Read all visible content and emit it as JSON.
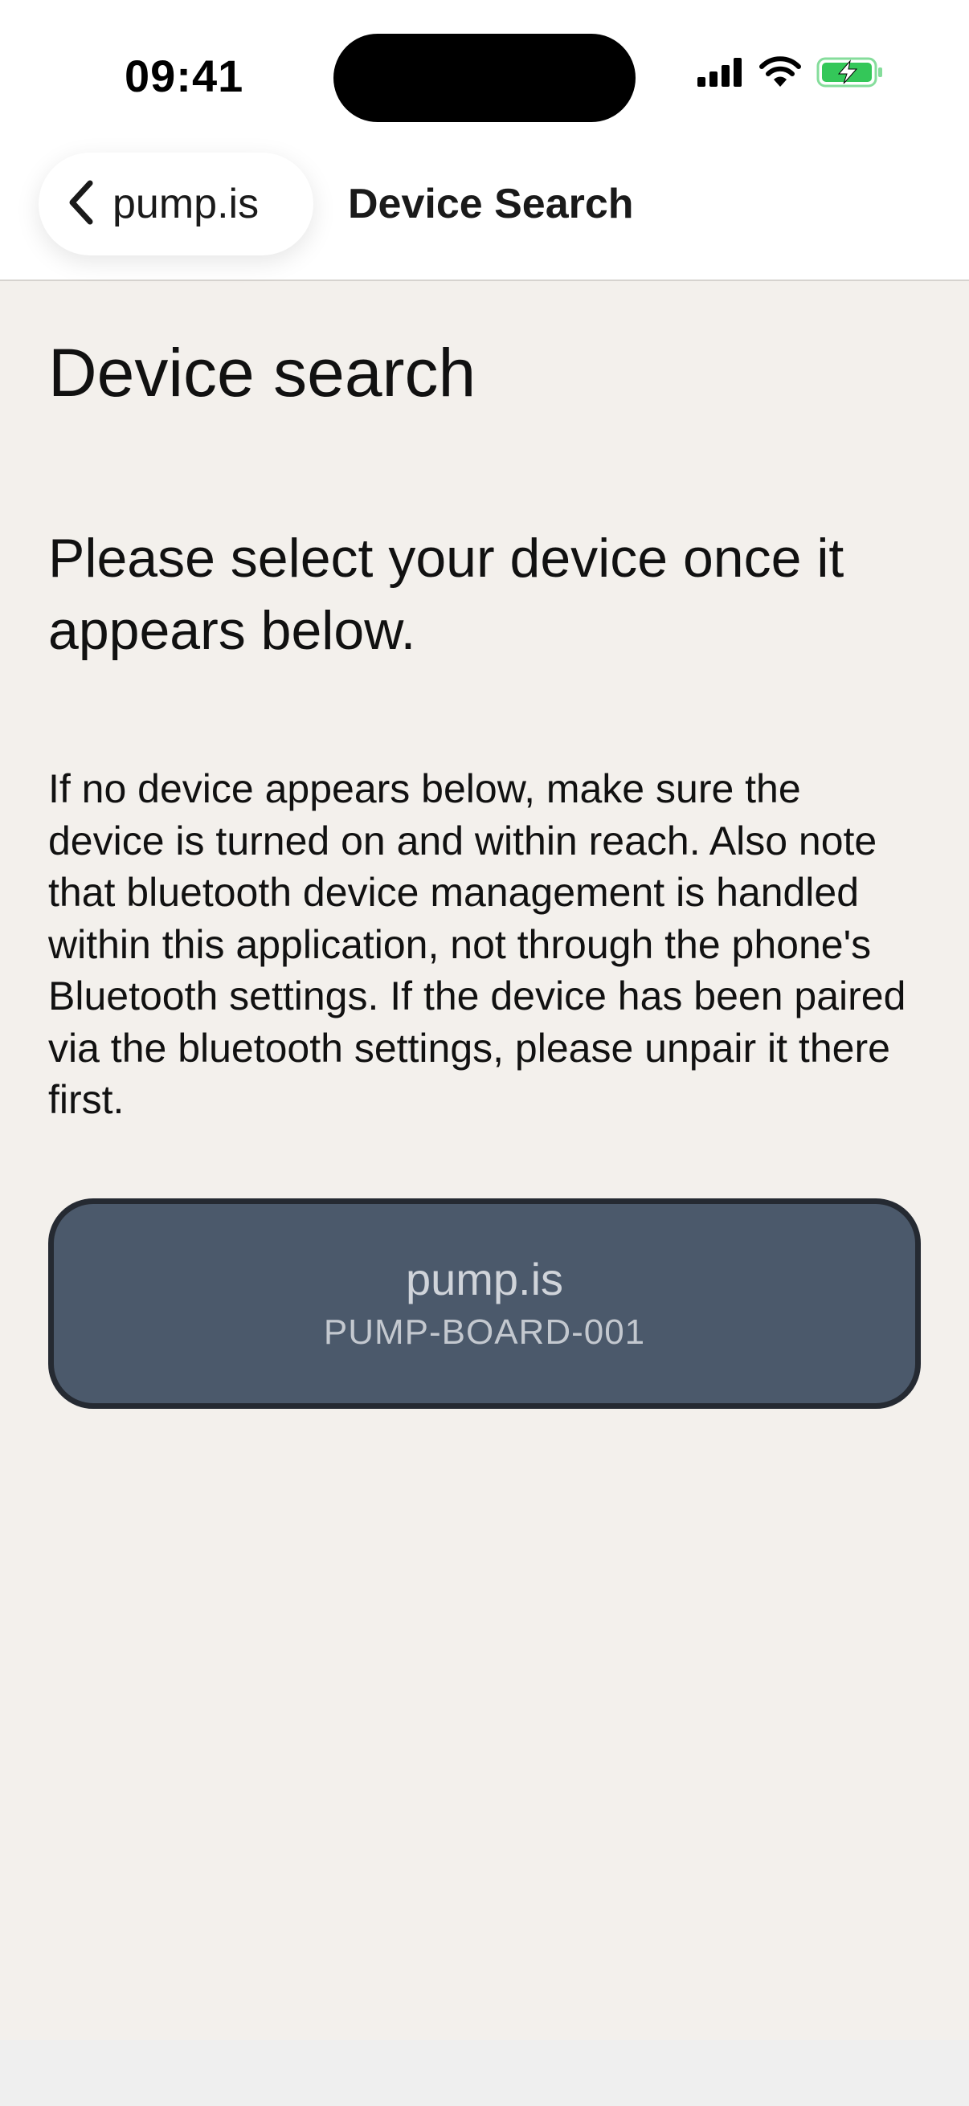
{
  "status_bar": {
    "time": "09:41",
    "icons": [
      "cellular-signal-icon",
      "wifi-icon",
      "battery-charging-icon"
    ],
    "battery_color": "#34c759"
  },
  "nav": {
    "back_label": "pump.is",
    "title": "Device Search"
  },
  "main": {
    "heading": "Device search",
    "subheading": "Please select your device once it appears below.",
    "info": "If no device appears below, make sure the device is turned on and within reach. Also note that bluetooth device management is handled within this application, not through the phone's Bluetooth settings. If the device has been paired via the bluetooth settings, please unpair it there first."
  },
  "devices": [
    {
      "name": "pump.is",
      "id": "PUMP-BOARD-001"
    }
  ],
  "colors": {
    "background": "#f3f0ec",
    "card_fill": "#4b596b",
    "card_border": "#252a32"
  }
}
